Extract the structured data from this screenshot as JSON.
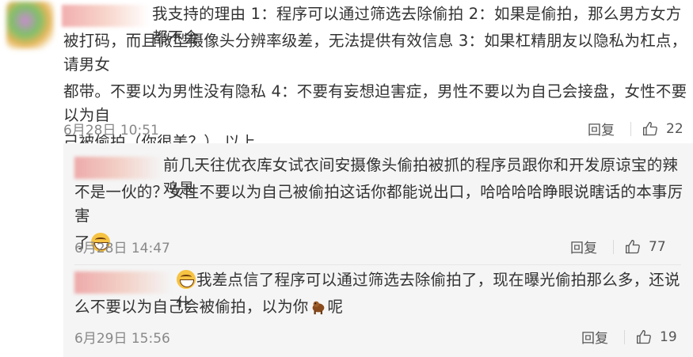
{
  "comments": [
    {
      "text_lines": [
        "我支持的理由 1：程序可以通过筛选去除偷拍 2：如果是偷拍，那么男方女方都不会",
        "被打码，而且微型摄像头分辨率级差，无法提供有效信息 3：如果杠精朋友以隐私为杠点，请男女",
        "都带。不要以为男性没有隐私 4：不要有妄想迫害症，男性不要以为自己会接盘，女性不要以为自",
        "己被偷拍（你很美？） 以上"
      ],
      "time": "6月28日 10:51",
      "reply_label": "回复",
      "likes": "22"
    },
    {
      "text_lines": [
        "前几天往优衣库女试衣间安摄像头偷拍被抓的程序员跟你和开发原谅宝的辣鸡是",
        "不是一伙的？女性不要以为自己被偷拍这话你都能说出口，哈哈哈哈睁眼说瞎话的本事厉害",
        "了"
      ],
      "time": "6月28日 14:47",
      "reply_label": "回复",
      "likes": "77"
    },
    {
      "text_lines": [
        "我差点信了程序可以通过筛选去除偷拍了，现在曝光偷拍那么多，还说什",
        "么不要以为自己会被偷拍，以为你",
        "呢"
      ],
      "time": "6月29日 15:56",
      "reply_label": "回复",
      "likes": "19"
    }
  ],
  "icons": {
    "like": "thumbs-up-icon",
    "grin": "grinning-emoji-icon",
    "dog": "dog-emoji-icon"
  }
}
